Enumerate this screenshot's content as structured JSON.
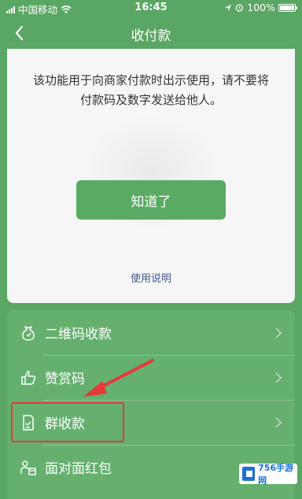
{
  "status_bar": {
    "carrier": "中国移动",
    "time": "16:45",
    "battery": "100%"
  },
  "nav": {
    "title": "收付款"
  },
  "card": {
    "notice": "该功能用于向商家付款时出示使用，请不要将付款码及数字发送给他人。",
    "ok_button": "知道了",
    "help_link": "使用说明"
  },
  "list": {
    "items": [
      {
        "label": "二维码收款",
        "icon": "money-bag-icon"
      },
      {
        "label": "赞赏码",
        "icon": "thumbs-up-icon"
      },
      {
        "label": "群收款",
        "icon": "group-bill-icon"
      },
      {
        "label": "面对面红包",
        "icon": "red-packet-icon"
      }
    ]
  },
  "watermark": {
    "text": "756手游网"
  },
  "colors": {
    "background": "#5aa664",
    "button": "#5aaa64",
    "link": "#3d5a85",
    "highlight": "#e43a3a"
  }
}
